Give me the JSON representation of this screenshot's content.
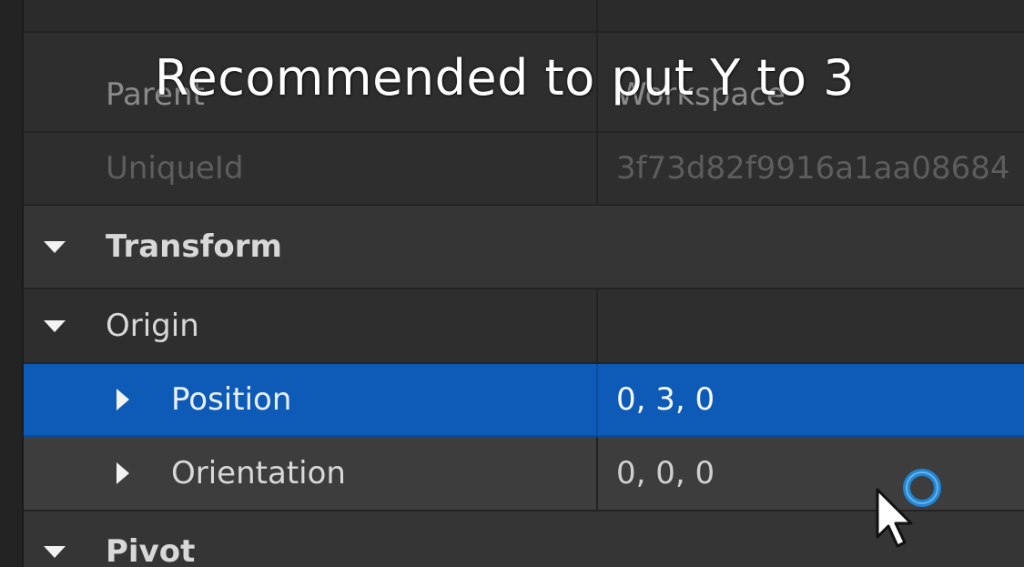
{
  "caption": "Recommended to put Y to 3",
  "properties": {
    "parent": {
      "label": "Parent",
      "value": "Workspace"
    },
    "unique_id": {
      "label": "UniqueId",
      "value": "3f73d82f9916a1aa08684"
    },
    "transform": {
      "label": "Transform"
    },
    "origin": {
      "label": "Origin"
    },
    "position": {
      "label": "Position",
      "value": "0, 3, 0"
    },
    "orientation": {
      "label": "Orientation",
      "value": "0, 0, 0"
    },
    "pivot": {
      "label": "Pivot"
    }
  },
  "icons": {
    "expand": "caret-down-icon",
    "collapse": "caret-right-icon",
    "cursor": "mouse-pointer-icon",
    "busy": "busy-spinner-icon"
  },
  "colors": {
    "selection": "#0e5ab7",
    "panel_bg": "#2e2e2e",
    "section_bg": "#353535",
    "text": "#d8d8d8",
    "dim_text": "#5d5d5d"
  }
}
